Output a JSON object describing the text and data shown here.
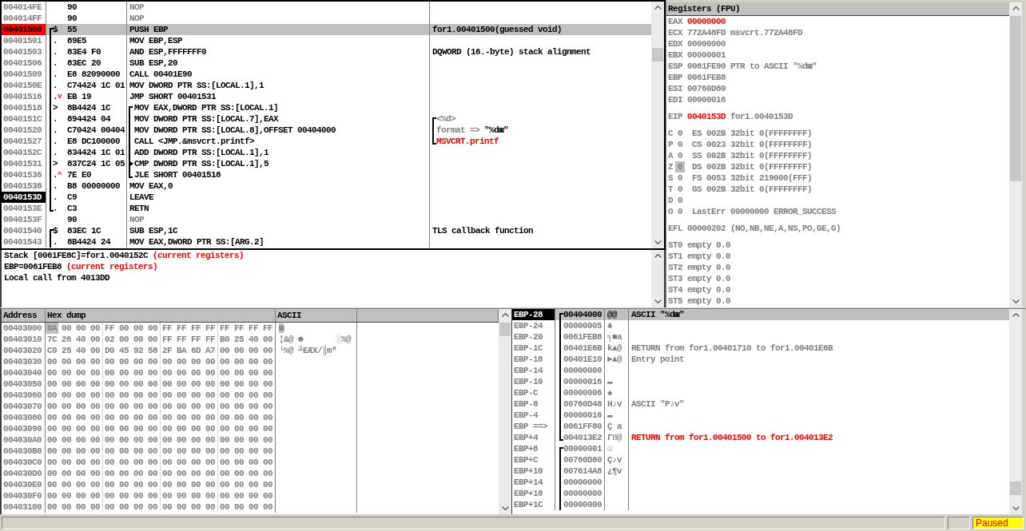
{
  "disassembly": {
    "rows": [
      {
        "address": "004014FE",
        "hex": "90",
        "instruction": "NOP",
        "kind": "filler",
        "selected": false,
        "breakpoint": false,
        "current": false
      },
      {
        "address": "004014FF",
        "hex": "90",
        "instruction": "NOP",
        "kind": "filler",
        "selected": false,
        "breakpoint": false,
        "current": false
      },
      {
        "address": "00401500",
        "marker": "$",
        "hex": "55",
        "instruction": "PUSH EBP",
        "kind": "code",
        "comment": {
          "text": "for1.00401500(guessed void)",
          "kind": "note"
        },
        "bracket": {
          "kind": "procedure_open"
        },
        "selected": true,
        "breakpoint": true,
        "current": false
      },
      {
        "address": "00401501",
        "marker": ".",
        "hex": "89E5",
        "instruction": "MOV EBP,ESP",
        "kind": "code",
        "selected": false,
        "breakpoint": false,
        "current": false
      },
      {
        "address": "00401503",
        "marker": ".",
        "hex": "83E4 F0",
        "instruction": "AND ESP,FFFFFFF0",
        "kind": "code",
        "comment": {
          "text": "DQWORD (16.-byte) stack alignment",
          "kind": "note"
        },
        "selected": false,
        "breakpoint": false,
        "current": false
      },
      {
        "address": "00401506",
        "marker": ".",
        "hex": "83EC 20",
        "instruction": "SUB ESP,20",
        "kind": "code",
        "selected": false,
        "breakpoint": false,
        "current": false
      },
      {
        "address": "00401509",
        "marker": ".",
        "hex": "E8 82090000",
        "instruction": "CALL 00401E90",
        "kind": "code",
        "selected": false,
        "breakpoint": false,
        "current": false
      },
      {
        "address": "0040150E",
        "marker": ".",
        "hex": "C74424 1C 01",
        "instruction": "MOV DWORD PTR SS:[LOCAL.1],1",
        "kind": "code",
        "selected": false,
        "breakpoint": false,
        "current": false
      },
      {
        "address": "00401516",
        "marker": ".",
        "jump": "v",
        "hex": "EB 19",
        "instruction": "JMP SHORT 00401531",
        "kind": "code",
        "selected": false,
        "breakpoint": false,
        "current": false
      },
      {
        "address": "00401518",
        "marker": ">",
        "hex": "8B4424 1C",
        "instruction": "MOV EAX,DWORD PTR SS:[LOCAL.1]",
        "kind": "code",
        "bracket": {
          "kind": "loop_open"
        },
        "selected": false,
        "breakpoint": false,
        "current": false
      },
      {
        "address": "0040151C",
        "marker": ".",
        "hex": "894424 04",
        "instruction": "MOV DWORD PTR SS:[LOCAL.7],EAX",
        "kind": "code",
        "comment": {
          "text": "<%d>",
          "kind": "argument"
        },
        "bracket": {
          "kind": "argument_open"
        },
        "selected": false,
        "breakpoint": false,
        "current": false
      },
      {
        "address": "00401520",
        "marker": ".",
        "hex": "C70424 00404",
        "instruction": "MOV DWORD PTR SS:[LOCAL.8],OFFSET 00404000",
        "kind": "code",
        "comment": {
          "text": "format =>",
          "value": "\"%d◙\"",
          "kind": "argument"
        },
        "selected": false,
        "breakpoint": false,
        "current": false
      },
      {
        "address": "00401527",
        "marker": ".",
        "hex": "E8 DC100000",
        "instruction": "CALL <JMP.&msvcrt.printf>",
        "kind": "code",
        "comment": {
          "text": "MSVCRT.printf",
          "kind": "api_call"
        },
        "bracket": {
          "kind": "argument_close"
        },
        "selected": false,
        "breakpoint": false,
        "current": false
      },
      {
        "address": "0040152C",
        "marker": ".",
        "hex": "834424 1C 01",
        "instruction": "ADD DWORD PTR SS:[LOCAL.1],1",
        "kind": "code",
        "selected": false,
        "breakpoint": false,
        "current": false
      },
      {
        "address": "00401531",
        "marker": ">",
        "hex": "837C24 1C 05",
        "instruction": "CMP DWORD PTR SS:[LOCAL.1],5",
        "kind": "code",
        "bracket": {
          "kind": "loop_entry"
        },
        "selected": false,
        "breakpoint": false,
        "current": false
      },
      {
        "address": "00401536",
        "marker": ".",
        "jump": "^",
        "hex": "7E E0",
        "instruction": "JLE SHORT 00401518",
        "kind": "code",
        "bracket": {
          "kind": "loop_close"
        },
        "selected": false,
        "breakpoint": false,
        "current": false
      },
      {
        "address": "00401538",
        "marker": ".",
        "hex": "B8 00000000",
        "instruction": "MOV EAX,0",
        "kind": "code",
        "selected": false,
        "breakpoint": false,
        "current": false
      },
      {
        "address": "0040153D",
        "marker": ".",
        "hex": "C9",
        "instruction": "LEAVE",
        "kind": "code",
        "selected": false,
        "breakpoint": false,
        "current": true
      },
      {
        "address": "0040153E",
        "marker": ".",
        "hex": "C3",
        "instruction": "RETN",
        "kind": "code",
        "bracket": {
          "kind": "procedure_close"
        },
        "selected": false,
        "breakpoint": false,
        "current": false
      },
      {
        "address": "0040153F",
        "hex": "90",
        "instruction": "NOP",
        "kind": "filler",
        "selected": false,
        "breakpoint": false,
        "current": false
      },
      {
        "address": "00401540",
        "marker": "$",
        "hex": "83EC 1C",
        "instruction": "SUB ESP,1C",
        "kind": "code",
        "comment": {
          "text": "TLS callback function",
          "kind": "note"
        },
        "bracket": {
          "kind": "procedure_open"
        },
        "selected": false,
        "breakpoint": false,
        "current": false
      },
      {
        "address": "00401543",
        "marker": ".",
        "hex": "8B4424 24",
        "instruction": "MOV EAX,DWORD PTR SS:[ARG.2]",
        "kind": "code",
        "selected": false,
        "breakpoint": false,
        "current": false
      }
    ]
  },
  "info": {
    "lines": [
      {
        "text": "Stack [0061FE8C]=for1.0040152C",
        "note": "(current registers)"
      },
      {
        "text": "EBP=0061FEB8",
        "note": "(current registers)"
      },
      {
        "text": "Local call from 4013DD"
      }
    ]
  },
  "registers": {
    "title": "Registers (FPU)",
    "general": [
      {
        "name": "EAX",
        "value": "00000000",
        "changed": true
      },
      {
        "name": "ECX",
        "value": "772A48FD",
        "changed": false,
        "comment": "msvcrt.772A48FD"
      },
      {
        "name": "EDX",
        "value": "00000000",
        "changed": false
      },
      {
        "name": "EBX",
        "value": "00000001",
        "changed": false
      },
      {
        "name": "ESP",
        "value": "0061FE90",
        "changed": false,
        "comment": "PTR to ASCII \"%d◙\""
      },
      {
        "name": "EBP",
        "value": "0061FEB8",
        "changed": false
      },
      {
        "name": "ESI",
        "value": "00760D80",
        "changed": false
      },
      {
        "name": "EDI",
        "value": "00000016",
        "changed": false
      }
    ],
    "eip": {
      "name": "EIP",
      "value": "0040153D",
      "changed": true,
      "comment": "for1.0040153D"
    },
    "flags": [
      {
        "name": "C",
        "value": "0",
        "selected": false,
        "detail": "ES 002B 32bit 0(FFFFFFFF)"
      },
      {
        "name": "P",
        "value": "0",
        "selected": false,
        "detail": "CS 0023 32bit 0(FFFFFFFF)"
      },
      {
        "name": "A",
        "value": "0",
        "selected": false,
        "detail": "SS 002B 32bit 0(FFFFFFFF)"
      },
      {
        "name": "Z",
        "value": "0",
        "selected": true,
        "detail": "DS 002B 32bit 0(FFFFFFFF)"
      },
      {
        "name": "S",
        "value": "0",
        "selected": false,
        "detail": "FS 0053 32bit 219000(FFF)"
      },
      {
        "name": "T",
        "value": "0",
        "selected": false,
        "detail": "GS 002B 32bit 0(FFFFFFFF)"
      },
      {
        "name": "D",
        "value": "0",
        "selected": false
      },
      {
        "name": "O",
        "value": "0",
        "selected": false,
        "detail": "LastErr 00000000 ERROR_SUCCESS"
      }
    ],
    "efl": {
      "name": "EFL",
      "value": "00000202",
      "comment": "(NO,NB,NE,A,NS,PO,GE,G)"
    },
    "fpu": [
      {
        "name": "ST0",
        "tag": "empty",
        "value": "0.0"
      },
      {
        "name": "ST1",
        "tag": "empty",
        "value": "0.0"
      },
      {
        "name": "ST2",
        "tag": "empty",
        "value": "0.0"
      },
      {
        "name": "ST3",
        "tag": "empty",
        "value": "0.0"
      },
      {
        "name": "ST4",
        "tag": "empty",
        "value": "0.0"
      },
      {
        "name": "ST5",
        "tag": "empty",
        "value": "0.0"
      }
    ]
  },
  "hex_dump": {
    "columns": [
      "Address",
      "Hex dump",
      "ASCII"
    ],
    "rows": [
      {
        "address": "00403000",
        "bytes": [
          "0A",
          "00",
          "00",
          "00",
          "FF",
          "00",
          "00",
          "00",
          "FF",
          "FF",
          "FF",
          "FF",
          "FF",
          "FF",
          "FF",
          "FF"
        ],
        "ascii": "◙",
        "selected": true
      },
      {
        "address": "00403010",
        "bytes": [
          "7C",
          "26",
          "40",
          "00",
          "02",
          "00",
          "00",
          "00",
          "FF",
          "FF",
          "FF",
          "FF",
          "B0",
          "25",
          "40",
          "00"
        ],
        "ascii": "¦&@ ☻       ░%@",
        "selected": false
      },
      {
        "address": "00403020",
        "bytes": [
          "C0",
          "25",
          "40",
          "00",
          "D0",
          "45",
          "92",
          "58",
          "2F",
          "BA",
          "6D",
          "A7",
          "00",
          "00",
          "00",
          "00"
        ],
        "ascii": "└%@ ╨EÆX/║mº",
        "selected": false
      },
      {
        "address": "00403030",
        "bytes": [
          "00",
          "00",
          "00",
          "00",
          "00",
          "00",
          "00",
          "00",
          "00",
          "00",
          "00",
          "00",
          "00",
          "00",
          "00",
          "00"
        ],
        "selected": false
      },
      {
        "address": "00403040",
        "bytes": [
          "00",
          "00",
          "00",
          "00",
          "00",
          "00",
          "00",
          "00",
          "00",
          "00",
          "00",
          "00",
          "00",
          "00",
          "00",
          "00"
        ],
        "selected": false
      },
      {
        "address": "00403050",
        "bytes": [
          "00",
          "00",
          "00",
          "00",
          "00",
          "00",
          "00",
          "00",
          "00",
          "00",
          "00",
          "00",
          "00",
          "00",
          "00",
          "00"
        ],
        "selected": false
      },
      {
        "address": "00403060",
        "bytes": [
          "00",
          "00",
          "00",
          "00",
          "00",
          "00",
          "00",
          "00",
          "00",
          "00",
          "00",
          "00",
          "00",
          "00",
          "00",
          "00"
        ],
        "selected": false
      },
      {
        "address": "00403070",
        "bytes": [
          "00",
          "00",
          "00",
          "00",
          "00",
          "00",
          "00",
          "00",
          "00",
          "00",
          "00",
          "00",
          "00",
          "00",
          "00",
          "00"
        ],
        "selected": false
      },
      {
        "address": "00403080",
        "bytes": [
          "00",
          "00",
          "00",
          "00",
          "00",
          "00",
          "00",
          "00",
          "00",
          "00",
          "00",
          "00",
          "00",
          "00",
          "00",
          "00"
        ],
        "selected": false
      },
      {
        "address": "00403090",
        "bytes": [
          "00",
          "00",
          "00",
          "00",
          "00",
          "00",
          "00",
          "00",
          "00",
          "00",
          "00",
          "00",
          "00",
          "00",
          "00",
          "00"
        ],
        "selected": false
      },
      {
        "address": "004030A0",
        "bytes": [
          "00",
          "00",
          "00",
          "00",
          "00",
          "00",
          "00",
          "00",
          "00",
          "00",
          "00",
          "00",
          "00",
          "00",
          "00",
          "00"
        ],
        "selected": false
      },
      {
        "address": "004030B0",
        "bytes": [
          "00",
          "00",
          "00",
          "00",
          "00",
          "00",
          "00",
          "00",
          "00",
          "00",
          "00",
          "00",
          "00",
          "00",
          "00",
          "00"
        ],
        "selected": false
      },
      {
        "address": "004030C0",
        "bytes": [
          "00",
          "00",
          "00",
          "00",
          "00",
          "00",
          "00",
          "00",
          "00",
          "00",
          "00",
          "00",
          "00",
          "00",
          "00",
          "00"
        ],
        "selected": false
      },
      {
        "address": "004030D0",
        "bytes": [
          "00",
          "00",
          "00",
          "00",
          "00",
          "00",
          "00",
          "00",
          "00",
          "00",
          "00",
          "00",
          "00",
          "00",
          "00",
          "00"
        ],
        "selected": false
      },
      {
        "address": "004030E0",
        "bytes": [
          "00",
          "00",
          "00",
          "00",
          "00",
          "00",
          "00",
          "00",
          "00",
          "00",
          "00",
          "00",
          "00",
          "00",
          "00",
          "00"
        ],
        "selected": false
      },
      {
        "address": "004030F0",
        "bytes": [
          "00",
          "00",
          "00",
          "00",
          "00",
          "00",
          "00",
          "00",
          "00",
          "00",
          "00",
          "00",
          "00",
          "00",
          "00",
          "00"
        ],
        "selected": false
      },
      {
        "address": "00403100",
        "bytes": [
          "00",
          "00",
          "00",
          "00",
          "00",
          "00",
          "00",
          "00",
          "00",
          "00",
          "00",
          "00",
          "00",
          "00",
          "00",
          "00"
        ],
        "selected": false
      }
    ]
  },
  "stack": {
    "rows": [
      {
        "label": "EBP-28",
        "value": "00404000",
        "ascii": "@@",
        "comment": {
          "text": "ASCII \"%d◙\"",
          "kind": "info"
        },
        "bracket": {
          "kind": "frame_open"
        },
        "selected": true,
        "top_of_stack": true
      },
      {
        "label": "EBP-24",
        "value": "00000005",
        "ascii": "♣",
        "selected": false,
        "top_of_stack": false
      },
      {
        "label": "EBP-20",
        "value": "0061FEB8",
        "ascii": "╕■a",
        "selected": false,
        "top_of_stack": false
      },
      {
        "label": "EBP-1C",
        "value": "00401E6B",
        "ascii": "k▲@",
        "comment": {
          "text": "RETURN from for1.00401710 to for1.00401E6B",
          "kind": "info"
        },
        "selected": false,
        "top_of_stack": false
      },
      {
        "label": "EBP-18",
        "value": "00401E10",
        "ascii": "►▲@",
        "comment": {
          "text": "Entry point",
          "kind": "info"
        },
        "selected": false,
        "top_of_stack": false
      },
      {
        "label": "EBP-14",
        "value": "00000000",
        "selected": false,
        "top_of_stack": false
      },
      {
        "label": "EBP-10",
        "value": "00000016",
        "ascii": "▬",
        "selected": false,
        "top_of_stack": false
      },
      {
        "label": "EBP-C",
        "value": "00000006",
        "ascii": "♠",
        "selected": false,
        "top_of_stack": false
      },
      {
        "label": "EBP-8",
        "value": "00760D48",
        "ascii": "H♪v",
        "comment": {
          "text": "ASCII \"P♪v\"",
          "kind": "info"
        },
        "selected": false,
        "top_of_stack": false
      },
      {
        "label": "EBP-4",
        "value": "00000016",
        "ascii": "▬",
        "selected": false,
        "top_of_stack": false
      },
      {
        "label": "EBP ==>",
        "value": "0061FF80",
        "ascii": "Ç a",
        "selected": false,
        "top_of_stack": false
      },
      {
        "label": "EBP+4",
        "value": "004013E2",
        "ascii": "Γ‼@",
        "comment": {
          "text": "RETURN from for1.00401500 to for1.004013E2",
          "kind": "caller_return"
        },
        "bracket": {
          "kind": "frame_close"
        },
        "selected": false,
        "top_of_stack": false
      },
      {
        "label": "EBP+8",
        "value": "00000001",
        "ascii": "☺",
        "bracket": {
          "kind": "frame_open"
        },
        "selected": false,
        "top_of_stack": false
      },
      {
        "label": "EBP+C",
        "value": "00760D80",
        "ascii": "Ç♪v",
        "selected": false,
        "top_of_stack": false
      },
      {
        "label": "EBP+10",
        "value": "007614A8",
        "ascii": "¿¶v",
        "selected": false,
        "top_of_stack": false
      },
      {
        "label": "EBP+14",
        "value": "00000000",
        "selected": false,
        "top_of_stack": false
      },
      {
        "label": "EBP+18",
        "value": "00000000",
        "selected": false,
        "top_of_stack": false
      },
      {
        "label": "EBP+1C",
        "value": "00000000",
        "selected": false,
        "top_of_stack": false
      }
    ]
  },
  "status_bar": {
    "state": "Paused"
  }
}
